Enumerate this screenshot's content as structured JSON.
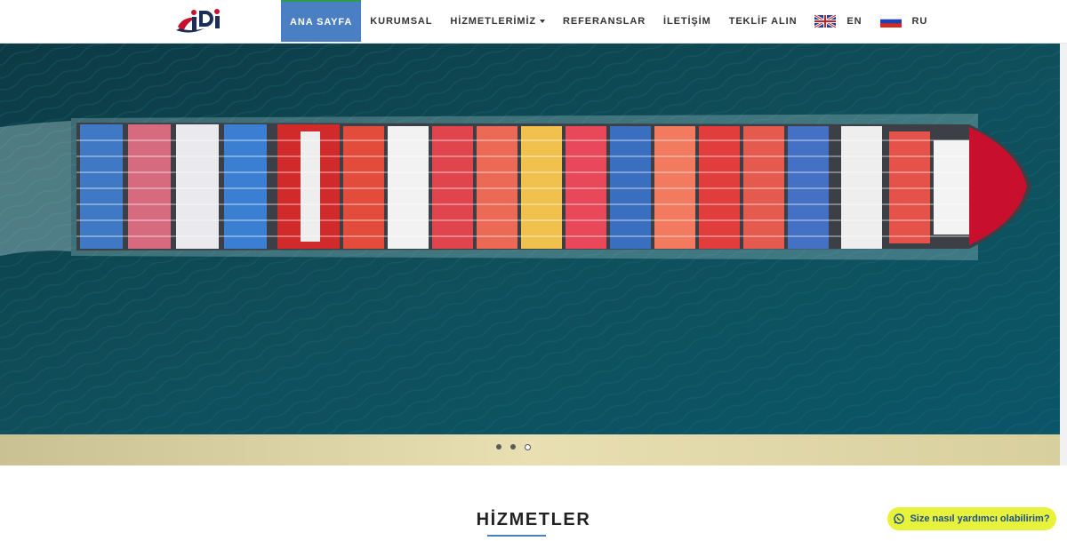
{
  "brand": {
    "logo_text": "iDi"
  },
  "nav": {
    "items": [
      {
        "label": "ANA SAYFA"
      },
      {
        "label": "KURUMSAL"
      },
      {
        "label": "HİZMETLERİMİZ"
      },
      {
        "label": "REFERANSLAR"
      },
      {
        "label": "İLETİŞİM"
      },
      {
        "label": "TEKLİF ALIN"
      },
      {
        "label": "EN"
      },
      {
        "label": "RU"
      }
    ]
  },
  "carousel": {
    "slide_count": 3,
    "active_index": 3
  },
  "section": {
    "title": "HİZMETLER"
  },
  "whatsapp": {
    "label": "Size nasıl yardımcı olabilirim?"
  },
  "colors": {
    "accent": "#4a7fc4",
    "active_border": "#2e9c4f",
    "whatsapp_bg": "#e6f33a"
  }
}
